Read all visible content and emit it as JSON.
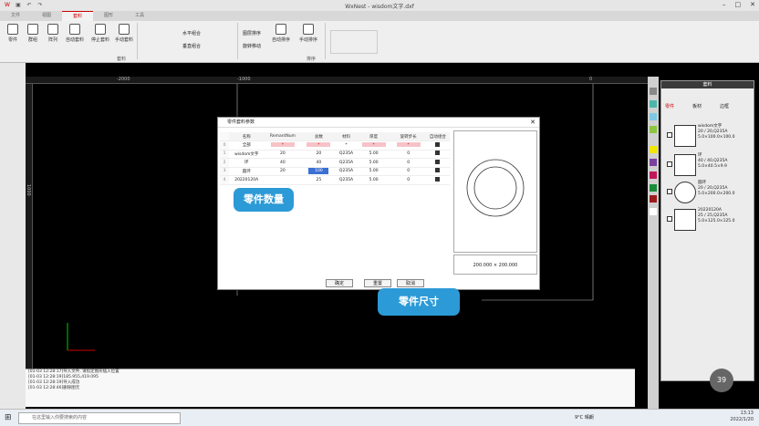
{
  "app": {
    "title": "WxNest - wisdom文字.dxf"
  },
  "tabs": [
    "文件",
    "视图",
    "套料",
    "图形",
    "工具"
  ],
  "active_tab": 2,
  "ribbon": {
    "buttons": [
      "零件",
      "群组",
      "阵列",
      "自动套料",
      "停止套料",
      "手动套料",
      "自动排序",
      "手动排序"
    ],
    "small": [
      "水平组合",
      "垂直组合",
      "图层排序",
      "旋转移动"
    ],
    "groups": [
      "套料",
      "排序"
    ]
  },
  "rulers": {
    "top": [
      "-2000",
      "-1000",
      "0"
    ],
    "left": [
      "1000"
    ]
  },
  "dialog": {
    "title": "零件套料参数",
    "headers": [
      "名称",
      "RemantNum",
      "总数",
      "材料",
      "厚度",
      "旋转步长",
      "自动组合"
    ],
    "rows": [
      {
        "no": "0",
        "name": "全部",
        "rem": "*",
        "total": "*",
        "mat": "*",
        "thick": "*",
        "rot": "*"
      },
      {
        "no": "1",
        "name": "wisdom文字",
        "rem": "20",
        "total": "20",
        "mat": "Q235A",
        "thick": "5.00",
        "rot": "0"
      },
      {
        "no": "2",
        "name": "环",
        "rem": "40",
        "total": "40",
        "mat": "Q235A",
        "thick": "5.00",
        "rot": "0"
      },
      {
        "no": "3",
        "name": "圆环",
        "rem": "20",
        "total": "100",
        "mat": "Q235A",
        "thick": "5.00",
        "rot": "0"
      },
      {
        "no": "4",
        "name": "20220120A",
        "rem": "",
        "total": "25",
        "mat": "Q235A",
        "thick": "5.00",
        "rot": "0"
      }
    ],
    "size": "200.000 × 200.000",
    "buttons": [
      "确定",
      "重置",
      "取消"
    ]
  },
  "callouts": {
    "qty": "零件数量",
    "size": "零件尺寸"
  },
  "panel": {
    "title": "套料",
    "tabs": [
      "零件",
      "板材",
      "边框"
    ],
    "items": [
      {
        "name": "wisdom文字",
        "l2": "20 / 20,Q235A",
        "l3": "5.0×100.0×100.0"
      },
      {
        "name": "环",
        "l2": "40 / 40,Q235A",
        "l3": "5.0×40.5×9.9"
      },
      {
        "name": "圆环",
        "l2": "20 / 20,Q235A",
        "l3": "5.0×200.0×200.0"
      },
      {
        "name": "20220120A",
        "l2": "25 / 25,Q235A",
        "l3": "5.0×125.0×125.0"
      }
    ]
  },
  "log": [
    "[01-03 12:28:17]导入文件, 请指定图形插入位置",
    "[01-03 12:28:19]185.955,419.095",
    "[01-03 12:28:19]导入成功",
    "[01-03 12:28:46]删除图元"
  ],
  "taskbar": {
    "search": "在这里输入你要搜索的内容",
    "weather": "9°C 晴朗",
    "time": "13:13",
    "date": "2022/1/20"
  },
  "badge": "39",
  "colors": {
    "accent": "#c00000",
    "callout": "#2c9ad6"
  }
}
